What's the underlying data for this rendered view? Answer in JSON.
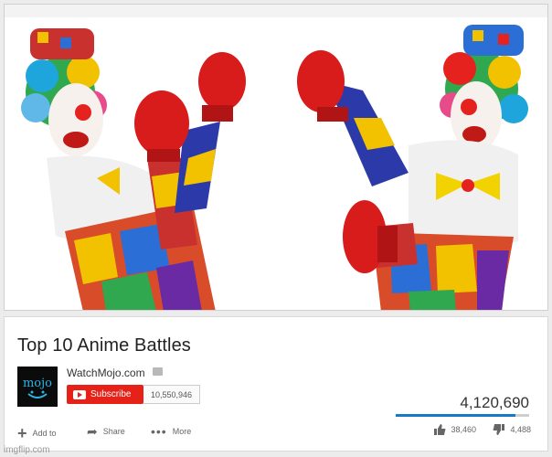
{
  "video": {
    "title": "Top 10 Anime Battles"
  },
  "channel": {
    "name": "WatchMojo.com",
    "logo_text": "mojo",
    "subscribe_label": "Subscribe",
    "subscriber_count": "10,550,946"
  },
  "stats": {
    "views": "4,120,690",
    "likes": "38,460",
    "dislikes": "4,488",
    "like_ratio": 0.9
  },
  "actions": {
    "add_label": "Add to",
    "share_label": "Share",
    "more_label": "More"
  },
  "watermark": "imgflip.com",
  "colors": {
    "subscribe": "#e62117",
    "like_bar": "#167ac6"
  }
}
